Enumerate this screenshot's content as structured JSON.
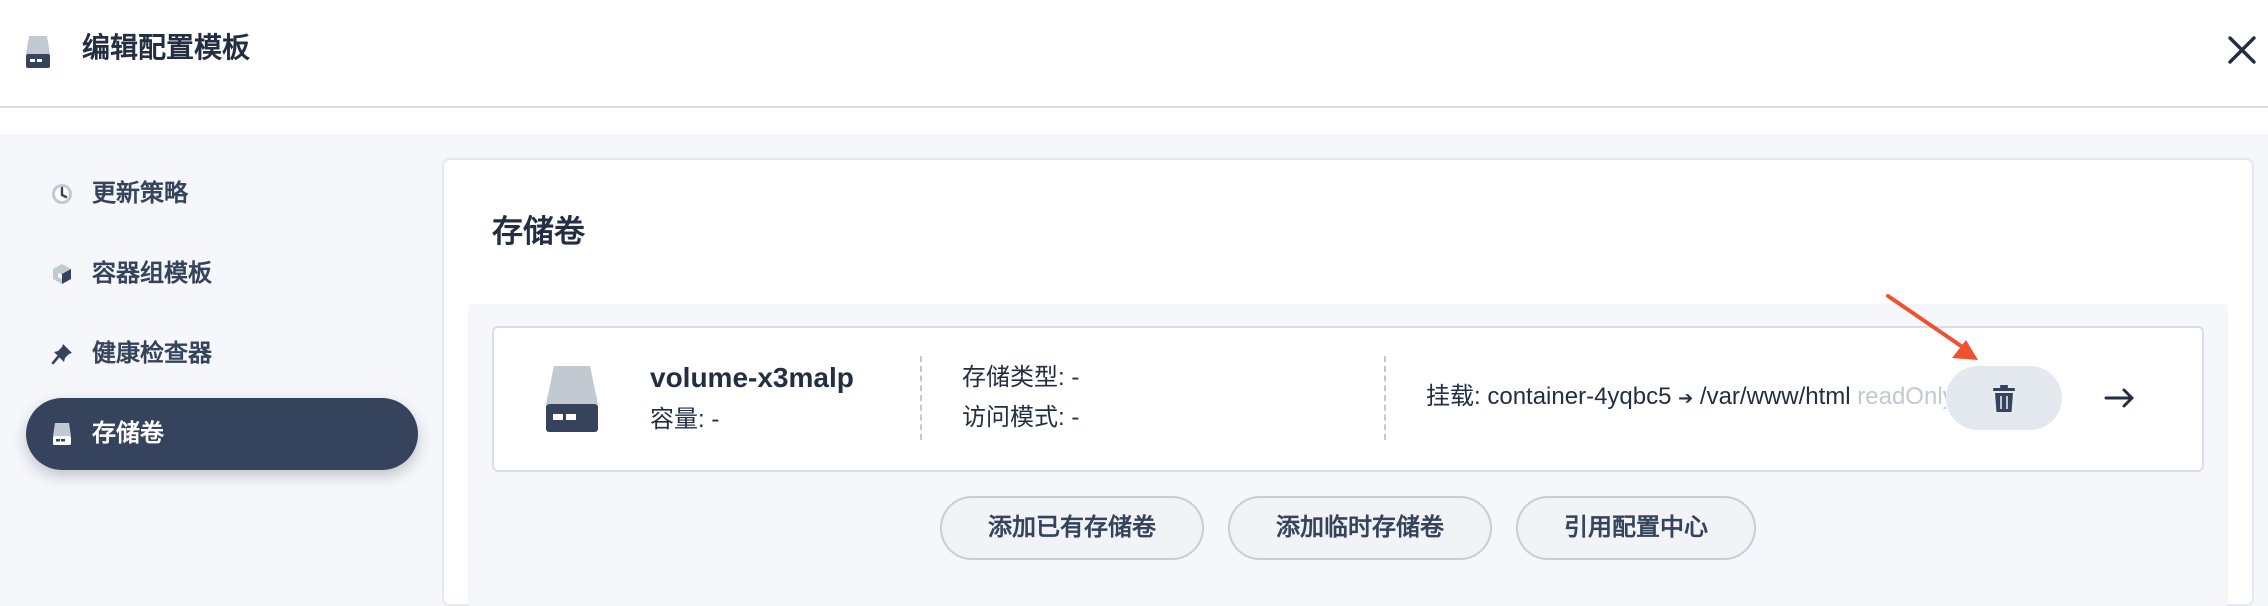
{
  "header": {
    "title": "编辑配置模板",
    "icon": "disk-icon",
    "close_icon": "close-icon"
  },
  "nav": {
    "items": [
      {
        "label": "更新策略",
        "icon": "update-strategy-icon"
      },
      {
        "label": "容器组模板",
        "icon": "pod-template-icon"
      },
      {
        "label": "健康检查器",
        "icon": "pin-icon"
      },
      {
        "label": "存储卷",
        "icon": "disk-icon",
        "active": true
      }
    ]
  },
  "main": {
    "title": "存储卷",
    "volume": {
      "name": "volume-x3malp",
      "capacity_label": "容量:",
      "capacity_value": "-",
      "storage_type_label": "存储类型:",
      "storage_type_value": "-",
      "access_mode_label": "访问模式:",
      "access_mode_value": "-",
      "mount_label": "挂载:",
      "mount_container": "container-4yqbc5",
      "mount_arrow": "➔",
      "mount_path": "/var/www/html",
      "mount_mode": "readOnly"
    },
    "buttons": {
      "add_existing": "添加已有存储卷",
      "add_temp": "添加临时存储卷",
      "ref_config": "引用配置中心"
    }
  },
  "colors": {
    "dark": "#36435c",
    "accent_arrow": "#f0512f",
    "muted": "#c1c9d1",
    "bg": "#f5f7fa"
  }
}
